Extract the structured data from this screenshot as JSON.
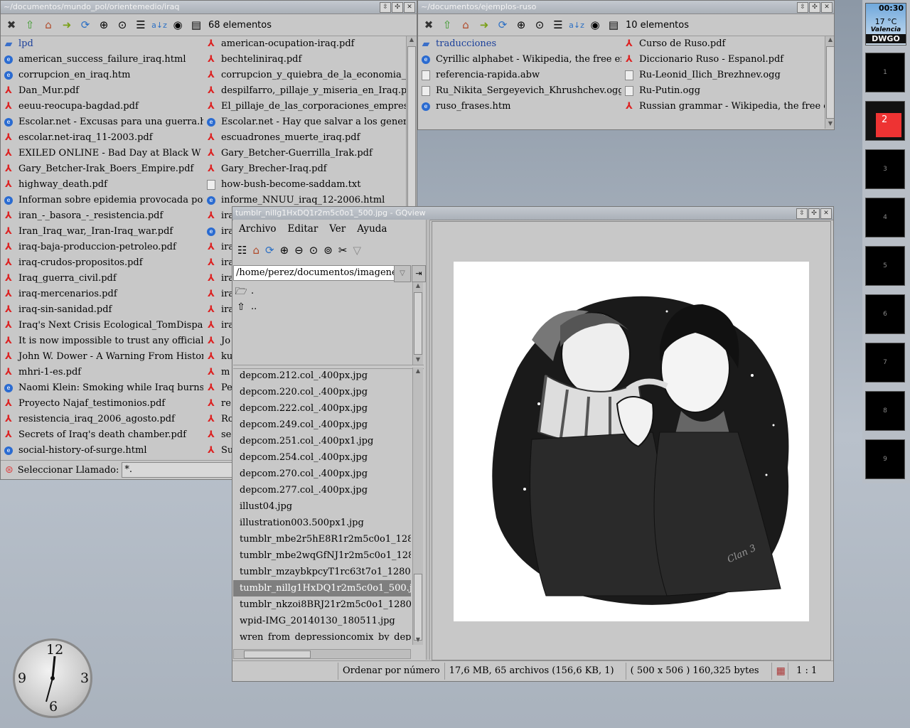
{
  "left_fm": {
    "title": "~/documentos/mundo_pol/orientemedio/iraq",
    "count": "68 elementos",
    "col1": [
      {
        "name": "lpd",
        "type": "folder"
      },
      {
        "name": "american_success_failure_iraq.html",
        "type": "web"
      },
      {
        "name": "corrupcion_en_iraq.htm",
        "type": "web"
      },
      {
        "name": "Dan_Mur.pdf",
        "type": "pdf"
      },
      {
        "name": "eeuu-reocupa-bagdad.pdf",
        "type": "pdf"
      },
      {
        "name": "Escolar.net - Excusas para una guerra.html",
        "type": "web"
      },
      {
        "name": "escolar.net-iraq_11-2003.pdf",
        "type": "pdf"
      },
      {
        "name": "EXILED ONLINE - Bad Day at Black W",
        "type": "pdf"
      },
      {
        "name": "Gary_Betcher-Irak_Boers_Empire.pdf",
        "type": "pdf"
      },
      {
        "name": "highway_death.pdf",
        "type": "pdf"
      },
      {
        "name": "Informan sobre epidemia provocada por",
        "type": "web"
      },
      {
        "name": "iran_-_basora_-_resistencia.pdf",
        "type": "pdf"
      },
      {
        "name": "Iran_Iraq_war,_Iran-Iraq_war.pdf",
        "type": "pdf"
      },
      {
        "name": "iraq-baja-produccion-petroleo.pdf",
        "type": "pdf"
      },
      {
        "name": "iraq-crudos-propositos.pdf",
        "type": "pdf"
      },
      {
        "name": "Iraq_guerra_civil.pdf",
        "type": "pdf"
      },
      {
        "name": "iraq-mercenarios.pdf",
        "type": "pdf"
      },
      {
        "name": "iraq-sin-sanidad.pdf",
        "type": "pdf"
      },
      {
        "name": "Iraq's Next Crisis Ecological_TomDispa",
        "type": "pdf"
      },
      {
        "name": "It is now impossible to trust any official",
        "type": "pdf"
      },
      {
        "name": "John W. Dower - A Warning From Histor",
        "type": "pdf"
      },
      {
        "name": "mhri-1-es.pdf",
        "type": "pdf"
      },
      {
        "name": "Naomi Klein: Smoking while Iraq burns.",
        "type": "web"
      },
      {
        "name": "Proyecto Najaf_testimonios.pdf",
        "type": "pdf"
      },
      {
        "name": "resistencia_iraq_2006_agosto.pdf",
        "type": "pdf"
      },
      {
        "name": "Secrets of Iraq's death chamber.pdf",
        "type": "pdf"
      },
      {
        "name": "social-history-of-surge.html",
        "type": "web"
      }
    ],
    "col2": [
      {
        "name": "american-ocupation-iraq.pdf",
        "type": "pdf"
      },
      {
        "name": "bechteliniraq.pdf",
        "type": "pdf"
      },
      {
        "name": "corrupcion_y_quiebra_de_la_economia_",
        "type": "pdf"
      },
      {
        "name": "despilfarro,_pillaje_y_miseria_en_Iraq.pd",
        "type": "pdf"
      },
      {
        "name": "El_pillaje_de_las_corporaciones_empres",
        "type": "pdf"
      },
      {
        "name": "Escolar.net - Hay que salvar a los genera",
        "type": "web"
      },
      {
        "name": "escuadrones_muerte_iraq.pdf",
        "type": "pdf"
      },
      {
        "name": "Gary_Betcher-Guerrilla_Irak.pdf",
        "type": "pdf"
      },
      {
        "name": "Gary_Brecher-Iraq.pdf",
        "type": "pdf"
      },
      {
        "name": "how-bush-become-saddam.txt",
        "type": "txt"
      },
      {
        "name": "informe_NNUU_iraq_12-2006.html",
        "type": "web"
      },
      {
        "name": "ira",
        "type": "pdf"
      },
      {
        "name": "ira",
        "type": "web"
      },
      {
        "name": "ira",
        "type": "pdf"
      },
      {
        "name": "ira",
        "type": "pdf"
      },
      {
        "name": "ira",
        "type": "pdf"
      },
      {
        "name": "ira",
        "type": "pdf"
      },
      {
        "name": "ira",
        "type": "pdf"
      },
      {
        "name": "ira",
        "type": "pdf"
      },
      {
        "name": "Jo",
        "type": "pdf"
      },
      {
        "name": "ku",
        "type": "pdf"
      },
      {
        "name": "m",
        "type": "pdf"
      },
      {
        "name": "Pe",
        "type": "pdf"
      },
      {
        "name": "re",
        "type": "pdf"
      },
      {
        "name": "Ro",
        "type": "pdf"
      },
      {
        "name": "se",
        "type": "pdf"
      },
      {
        "name": "Su",
        "type": "pdf"
      }
    ],
    "select_label": "Seleccionar Llamado:",
    "select_value": "*."
  },
  "right_fm": {
    "title": "~/documentos/ejemplos-ruso",
    "count": "10 elementos",
    "col1": [
      {
        "name": "traducciones",
        "type": "folder"
      },
      {
        "name": "Cyrillic alphabet - Wikipedia, the free en",
        "type": "web"
      },
      {
        "name": "referencia-rapida.abw",
        "type": "txt"
      },
      {
        "name": "Ru_Nikita_Sergeyevich_Khrushchev.ogg",
        "type": "txt"
      },
      {
        "name": "ruso_frases.htm",
        "type": "web"
      }
    ],
    "col2": [
      {
        "name": "Curso de Ruso.pdf",
        "type": "pdf"
      },
      {
        "name": "Diccionario Ruso - Espanol.pdf",
        "type": "pdf"
      },
      {
        "name": "Ru-Leonid_Ilich_Brezhnev.ogg",
        "type": "txt"
      },
      {
        "name": "Ru-Putin.ogg",
        "type": "txt"
      },
      {
        "name": "Russian grammar - Wikipedia, the free e",
        "type": "pdf"
      }
    ]
  },
  "gqview": {
    "title": "tumblr_nillg1HxDQ1r2m5c0o1_500.jpg - GQview",
    "menu": [
      "Archivo",
      "Editar",
      "Ver",
      "Ayuda"
    ],
    "path": "/home/perez/documentos/imagenes",
    "dirs": [
      ".",
      ".."
    ],
    "images": [
      "depcom.212.col_.400px.jpg",
      "depcom.220.col_.400px.jpg",
      "depcom.222.col_.400px.jpg",
      "depcom.249.col_.400px.jpg",
      "depcom.251.col_.400px1.jpg",
      "depcom.254.col_.400px.jpg",
      "depcom.270.col_.400px.jpg",
      "depcom.277.col_.400px.jpg",
      "illust04.jpg",
      "illustration003.500px1.jpg",
      "tumblr_mbe2r5hE8R1r2m5c0o1_128",
      "tumblr_mbe2wqGfNJ1r2m5c0o1_128",
      "tumblr_mzaybkpcyT1rc63t7o1_1280.",
      "tumblr_nillg1HxDQ1r2m5c0o1_500.j",
      "tumblr_nkzoi8BRJ21r2m5c0o1_1280",
      "wpid-IMG_20140130_180511.jpg",
      "wren_from_depressioncomix_by_dep"
    ],
    "selected_index": 13,
    "status_sort": "Ordenar por número",
    "status_files": "17,6 MB, 65 archivos (156,6 KB, 1)",
    "status_size": "( 500 x 506 ) 160,325 bytes",
    "status_zoom": "1 : 1",
    "signature": "Clan 3"
  },
  "dock": {
    "time": "00:30",
    "temp": "17 °C",
    "city": "Valencia",
    "brand": "DWGO",
    "workspaces": [
      "1",
      "2",
      "3",
      "4",
      "5",
      "6",
      "7",
      "8",
      "9"
    ],
    "active_workspace": "2"
  },
  "clock": {
    "n12": "12",
    "n3": "3",
    "n6": "6",
    "n9": "9"
  }
}
